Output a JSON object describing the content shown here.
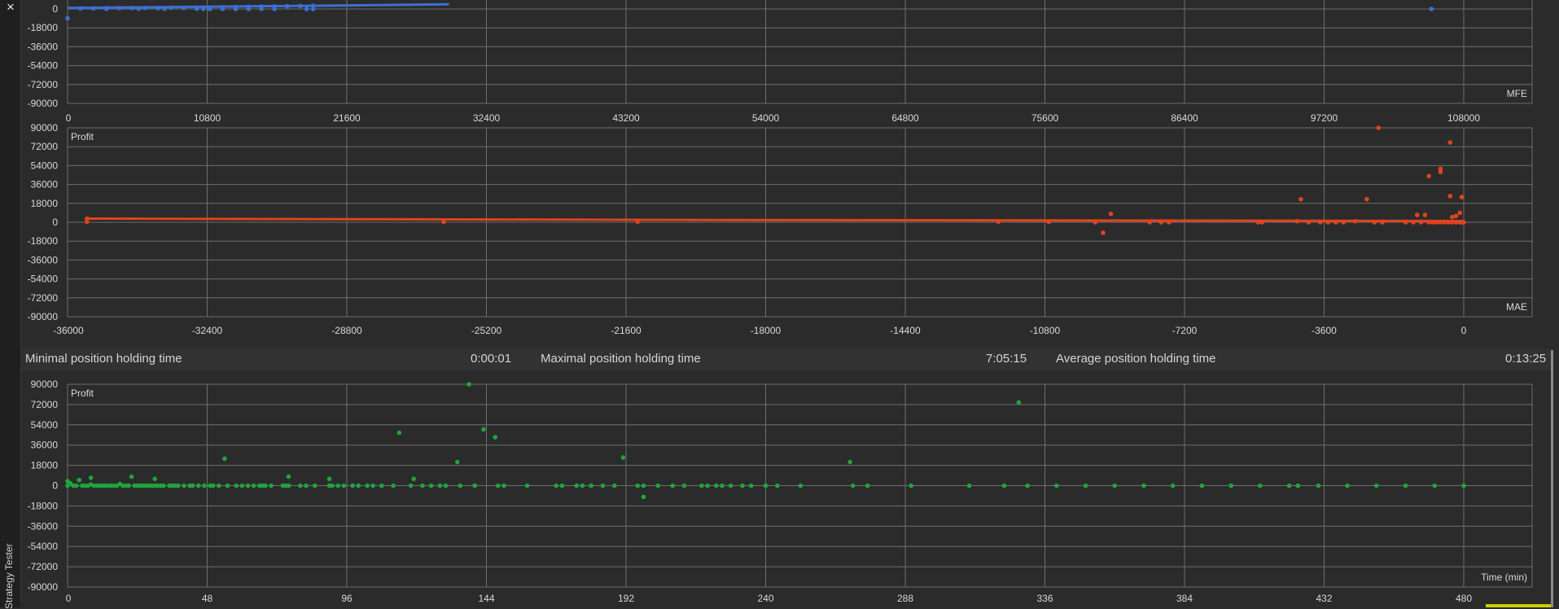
{
  "window": {
    "close_label": "×",
    "tab_label": "Strategy Tester"
  },
  "holding_times": {
    "min_label": "Minimal position holding time",
    "min_value": "0:00:01",
    "max_label": "Maximal position holding time",
    "max_value": "7:05:15",
    "avg_label": "Average position holding time",
    "avg_value": "0:13:25"
  },
  "colors": {
    "mfe": "#3b6fd6",
    "mae": "#e0431f",
    "time": "#1fa43c",
    "grid": "#6e6e6e",
    "plot_bg": "#2b2b2b"
  },
  "chart_data": [
    {
      "type": "scatter",
      "title": "",
      "xlabel": "MFE",
      "ylabel": "",
      "xlim": [
        0,
        108000
      ],
      "ylim": [
        -90000,
        18000
      ],
      "x_ticks": [
        "0",
        "10800",
        "21600",
        "32400",
        "43200",
        "54000",
        "64800",
        "75600",
        "86400",
        "97200",
        "108000"
      ],
      "y_ticks": [
        "0",
        "-18000",
        "-36000",
        "-54000",
        "-72000",
        "-90000"
      ],
      "series": [
        {
          "points": [
            [
              0,
              -9000
            ],
            [
              1000,
              500
            ],
            [
              2000,
              600
            ],
            [
              3000,
              700
            ],
            [
              4000,
              800
            ],
            [
              5000,
              900
            ],
            [
              6000,
              1000
            ],
            [
              7000,
              800
            ],
            [
              8000,
              1200
            ],
            [
              9000,
              1000
            ],
            [
              10000,
              1100
            ],
            [
              11000,
              1300
            ],
            [
              12000,
              1500
            ],
            [
              13000,
              1800
            ],
            [
              14000,
              2000
            ],
            [
              15000,
              2200
            ],
            [
              16000,
              2400
            ],
            [
              17000,
              2600
            ],
            [
              18000,
              2800
            ],
            [
              19000,
              3000
            ],
            [
              3000,
              100
            ],
            [
              5500,
              300
            ],
            [
              7500,
              200
            ],
            [
              10000,
              200
            ],
            [
              10500,
              150
            ],
            [
              11000,
              0
            ],
            [
              12000,
              100
            ],
            [
              13000,
              0
            ],
            [
              14000,
              0
            ],
            [
              15000,
              200
            ],
            [
              16000,
              0
            ],
            [
              18500,
              0
            ],
            [
              19000,
              0
            ],
            [
              25500,
              12000
            ],
            [
              29500,
              11000
            ],
            [
              105500,
              0
            ]
          ]
        }
      ]
    },
    {
      "type": "scatter",
      "title": "",
      "xlabel": "MAE",
      "ylabel": "Profit",
      "xlim": [
        -36000,
        0
      ],
      "ylim": [
        -90000,
        90000
      ],
      "x_ticks": [
        "-36000",
        "-32400",
        "-28800",
        "-25200",
        "-21600",
        "-18000",
        "-14400",
        "-10800",
        "-7200",
        "-3600",
        "0"
      ],
      "y_ticks": [
        "90000",
        "72000",
        "54000",
        "36000",
        "18000",
        "0",
        "-18000",
        "-36000",
        "-54000",
        "-72000",
        "-90000"
      ],
      "series": [
        {
          "points": [
            [
              -35500,
              500
            ],
            [
              -35500,
              3500
            ],
            [
              -26300,
              500
            ],
            [
              -21300,
              500
            ],
            [
              -12000,
              500
            ],
            [
              -10700,
              500
            ],
            [
              -9500,
              0
            ],
            [
              -9300,
              -10000
            ],
            [
              -9100,
              8000
            ],
            [
              -8100,
              0
            ],
            [
              -7800,
              0
            ],
            [
              -7600,
              0
            ],
            [
              -5300,
              0
            ],
            [
              -5200,
              0
            ],
            [
              -4300,
              1000
            ],
            [
              -4200,
              22000
            ],
            [
              -4000,
              0
            ],
            [
              -3700,
              0
            ],
            [
              -3500,
              0
            ],
            [
              -3300,
              0
            ],
            [
              -3100,
              0
            ],
            [
              -2800,
              1000
            ],
            [
              -2500,
              22000
            ],
            [
              -2300,
              0
            ],
            [
              -2100,
              0
            ],
            [
              -2200,
              90000
            ],
            [
              -1500,
              0
            ],
            [
              -1300,
              0
            ],
            [
              -1200,
              7000
            ],
            [
              -1100,
              0
            ],
            [
              -1000,
              7000
            ],
            [
              -900,
              0
            ],
            [
              -800,
              0
            ],
            [
              -700,
              0
            ],
            [
              -600,
              0
            ],
            [
              -500,
              0
            ],
            [
              -400,
              0
            ],
            [
              -300,
              0
            ],
            [
              -200,
              0
            ],
            [
              -100,
              0
            ],
            [
              -50,
              0
            ],
            [
              -900,
              44000
            ],
            [
              -600,
              51000
            ],
            [
              -600,
              48000
            ],
            [
              -350,
              76000
            ],
            [
              -350,
              25000
            ],
            [
              -300,
              5000
            ],
            [
              -200,
              6000
            ],
            [
              -100,
              9000
            ],
            [
              -50,
              24000
            ],
            [
              -50,
              0
            ],
            [
              0,
              0
            ]
          ]
        }
      ]
    },
    {
      "type": "scatter",
      "title": "",
      "xlabel": "Time (min)",
      "ylabel": "Profit",
      "xlim": [
        0,
        480
      ],
      "ylim": [
        -90000,
        90000
      ],
      "x_ticks": [
        "0",
        "48",
        "96",
        "144",
        "192",
        "240",
        "288",
        "336",
        "384",
        "432",
        "480"
      ],
      "y_ticks": [
        "90000",
        "72000",
        "54000",
        "36000",
        "18000",
        "0",
        "-18000",
        "-36000",
        "-54000",
        "-72000",
        "-90000"
      ],
      "series": [
        {
          "points": [
            [
              0,
              0
            ],
            [
              1,
              2000
            ],
            [
              2,
              0
            ],
            [
              3,
              0
            ],
            [
              4,
              5000
            ],
            [
              5,
              0
            ],
            [
              6,
              0
            ],
            [
              7,
              0
            ],
            [
              8,
              1000
            ],
            [
              9,
              0
            ],
            [
              10,
              0
            ],
            [
              11,
              0
            ],
            [
              12,
              0
            ],
            [
              13,
              0
            ],
            [
              14,
              0
            ],
            [
              15,
              0
            ],
            [
              16,
              0
            ],
            [
              17,
              0
            ],
            [
              18,
              1500
            ],
            [
              19,
              0
            ],
            [
              20,
              0
            ],
            [
              21,
              0
            ],
            [
              22,
              8000
            ],
            [
              23,
              0
            ],
            [
              24,
              0
            ],
            [
              25,
              0
            ],
            [
              26,
              0
            ],
            [
              27,
              0
            ],
            [
              28,
              0
            ],
            [
              29,
              0
            ],
            [
              30,
              0
            ],
            [
              31,
              0
            ],
            [
              32,
              0
            ],
            [
              33,
              0
            ],
            [
              35,
              0
            ],
            [
              36,
              0
            ],
            [
              37,
              0
            ],
            [
              38,
              0
            ],
            [
              40,
              0
            ],
            [
              42,
              0
            ],
            [
              43,
              0
            ],
            [
              45,
              0
            ],
            [
              47,
              0
            ],
            [
              49,
              0
            ],
            [
              50,
              0
            ],
            [
              52,
              0
            ],
            [
              55,
              0
            ],
            [
              58,
              0
            ],
            [
              60,
              0
            ],
            [
              62,
              0
            ],
            [
              64,
              0
            ],
            [
              66,
              0
            ],
            [
              67,
              0
            ],
            [
              68,
              0
            ],
            [
              70,
              0
            ],
            [
              74,
              0
            ],
            [
              75,
              0
            ],
            [
              76,
              0
            ],
            [
              80,
              0
            ],
            [
              82,
              0
            ],
            [
              85,
              0
            ],
            [
              90,
              0
            ],
            [
              91,
              0
            ],
            [
              93,
              0
            ],
            [
              95,
              0
            ],
            [
              98,
              0
            ],
            [
              100,
              0
            ],
            [
              103,
              0
            ],
            [
              105,
              0
            ],
            [
              108,
              0
            ],
            [
              112,
              0
            ],
            [
              118,
              0
            ],
            [
              122,
              0
            ],
            [
              125,
              0
            ],
            [
              128,
              0
            ],
            [
              130,
              0
            ],
            [
              135,
              0
            ],
            [
              140,
              0
            ],
            [
              148,
              0
            ],
            [
              158,
              0
            ],
            [
              168,
              0
            ],
            [
              170,
              0
            ],
            [
              175,
              0
            ],
            [
              177,
              0
            ],
            [
              180,
              0
            ],
            [
              184,
              0
            ],
            [
              188,
              0
            ],
            [
              196,
              0
            ],
            [
              198,
              0
            ],
            [
              208,
              0
            ],
            [
              212,
              0
            ],
            [
              220,
              0
            ],
            [
              223,
              0
            ],
            [
              225,
              0
            ],
            [
              228,
              0
            ],
            [
              232,
              0
            ],
            [
              240,
              0
            ],
            [
              244,
              0
            ],
            [
              270,
              0
            ],
            [
              275,
              0
            ],
            [
              290,
              0
            ],
            [
              310,
              0
            ],
            [
              322,
              0
            ],
            [
              330,
              0
            ],
            [
              340,
              0
            ],
            [
              350,
              0
            ],
            [
              360,
              0
            ],
            [
              370,
              0
            ],
            [
              380,
              0
            ],
            [
              390,
              0
            ],
            [
              400,
              0
            ],
            [
              410,
              0
            ],
            [
              420,
              0
            ],
            [
              423,
              0
            ],
            [
              430,
              0
            ],
            [
              440,
              0
            ],
            [
              450,
              0
            ],
            [
              460,
              0
            ],
            [
              470,
              0
            ],
            [
              480,
              0
            ],
            [
              0,
              4000
            ],
            [
              8,
              7000
            ],
            [
              30,
              6000
            ],
            [
              54,
              24000
            ],
            [
              76,
              8000
            ],
            [
              90,
              6000
            ],
            [
              114,
              47000
            ],
            [
              119,
              6000
            ],
            [
              134,
              21000
            ],
            [
              138,
              90000
            ],
            [
              140,
              0
            ],
            [
              143,
              50000
            ],
            [
              147,
              43000
            ],
            [
              150,
              0
            ],
            [
              180,
              0
            ],
            [
              191,
              25000
            ],
            [
              198,
              -10000
            ],
            [
              203,
              0
            ],
            [
              218,
              0
            ],
            [
              235,
              0
            ],
            [
              252,
              0
            ],
            [
              269,
              21000
            ],
            [
              327,
              74000
            ],
            [
              400,
              0
            ],
            [
              423,
              0
            ]
          ]
        }
      ]
    }
  ]
}
